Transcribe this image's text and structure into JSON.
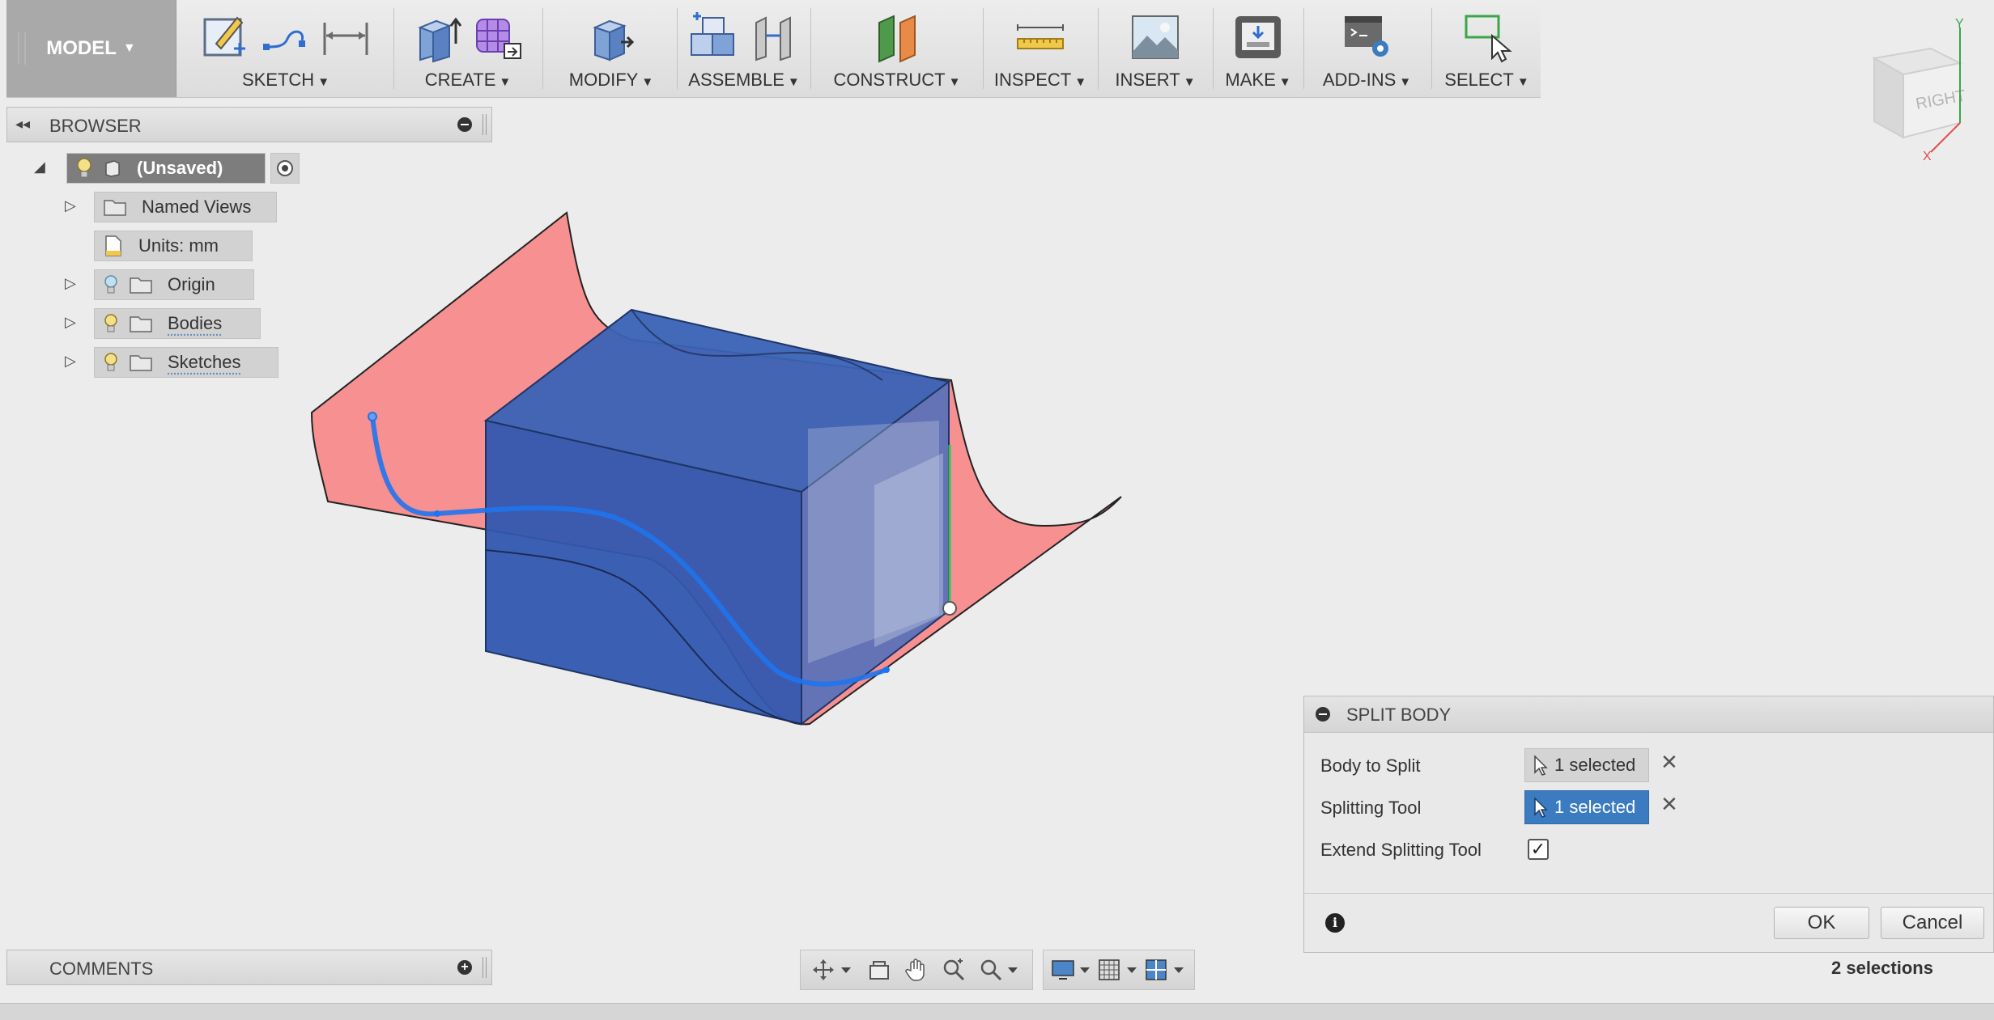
{
  "toolbar": {
    "workspace": "MODEL",
    "groups": [
      {
        "label": "SKETCH"
      },
      {
        "label": "CREATE"
      },
      {
        "label": "MODIFY"
      },
      {
        "label": "ASSEMBLE"
      },
      {
        "label": "CONSTRUCT"
      },
      {
        "label": "INSPECT"
      },
      {
        "label": "INSERT"
      },
      {
        "label": "MAKE"
      },
      {
        "label": "ADD-INS"
      },
      {
        "label": "SELECT"
      }
    ]
  },
  "browser": {
    "title": "BROWSER",
    "root": "(Unsaved)",
    "items": [
      {
        "label": "Named Views"
      },
      {
        "label": "Units: mm"
      },
      {
        "label": "Origin"
      },
      {
        "label": "Bodies"
      },
      {
        "label": "Sketches"
      }
    ]
  },
  "comments": {
    "title": "COMMENTS"
  },
  "viewcube": {
    "face": "RIGHT",
    "axis_y": "Y",
    "axis_x": "X"
  },
  "dialog": {
    "title": "SPLIT BODY",
    "rows": [
      {
        "label": "Body to Split",
        "value": "1 selected"
      },
      {
        "label": "Splitting Tool",
        "value": "1 selected"
      },
      {
        "label": "Extend Splitting Tool",
        "checked": true
      }
    ],
    "ok": "OK",
    "cancel": "Cancel"
  },
  "status": {
    "selections": "2 selections"
  },
  "colors": {
    "surface": "#f79090",
    "box": "#2f5fb8",
    "accent": "#3b7bbf"
  }
}
